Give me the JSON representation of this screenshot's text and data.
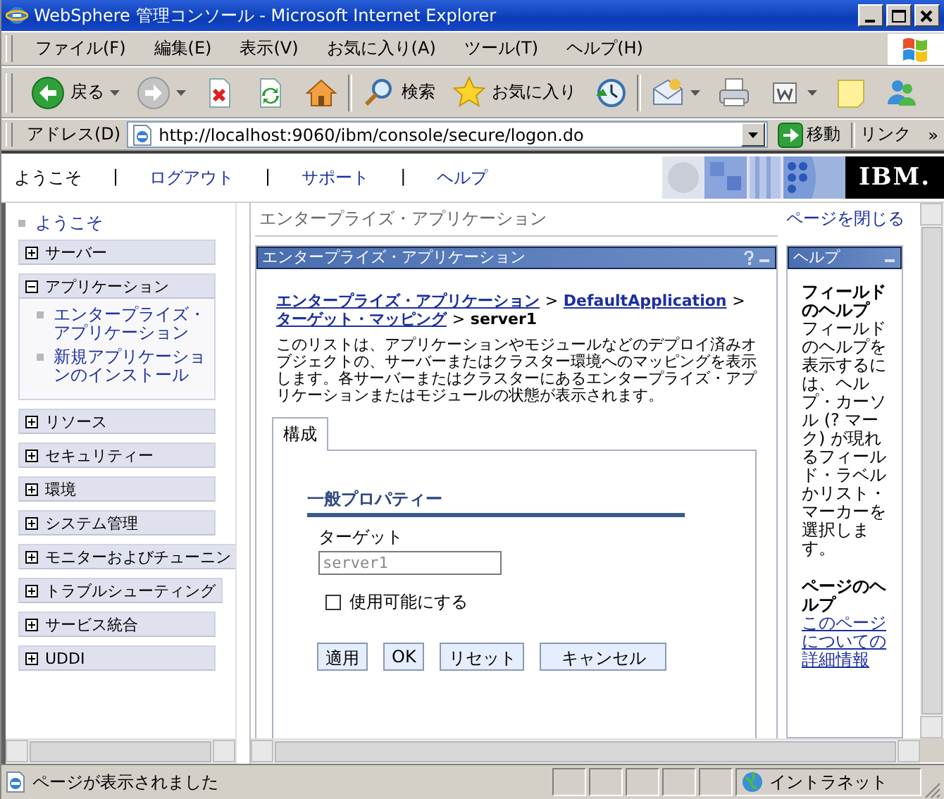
{
  "window": {
    "title": "WebSphere 管理コンソール - Microsoft Internet Explorer"
  },
  "menu": [
    "ファイル(F)",
    "編集(E)",
    "表示(V)",
    "お気に入り(A)",
    "ツール(T)",
    "ヘルプ(H)"
  ],
  "toolbar": [
    {
      "kind": "back",
      "label": "戻る",
      "menu": true
    },
    {
      "kind": "forward",
      "menu": true
    },
    {
      "kind": "stop",
      "menu": false
    },
    {
      "kind": "refresh",
      "menu": false
    },
    {
      "kind": "home",
      "menu": false
    },
    {
      "kind": "search",
      "label": "検索",
      "menu": false
    },
    {
      "kind": "favorites",
      "label": "お気に入り",
      "menu": false
    },
    {
      "kind": "history",
      "menu": false
    },
    {
      "kind": "mail",
      "menu": true
    },
    {
      "kind": "print",
      "menu": false
    },
    {
      "kind": "edit",
      "menu": true
    },
    {
      "kind": "note",
      "menu": false
    },
    {
      "kind": "people",
      "menu": false
    }
  ],
  "address": {
    "label": "アドレス(D)",
    "value": "http://localhost:9060/ibm/console/secure/logon.do",
    "go": "移動",
    "links": "リンク",
    "more": "»"
  },
  "banner": {
    "items": [
      {
        "kind": "text",
        "label": "ようこそ"
      },
      {
        "kind": "sep",
        "label": "|"
      },
      {
        "kind": "link",
        "label": "ログアウト"
      },
      {
        "kind": "sep",
        "label": "|"
      },
      {
        "kind": "link",
        "label": "サポート"
      },
      {
        "kind": "sep",
        "label": "|"
      },
      {
        "kind": "link",
        "label": "ヘルプ"
      }
    ],
    "logo": "IBM."
  },
  "nav": {
    "welcome": "ようこそ",
    "groups": [
      {
        "label": "サーバー",
        "expanded": false
      },
      {
        "label": "アプリケーション",
        "expanded": true,
        "children": [
          {
            "label": "エンタープライズ・アプリケーション"
          },
          {
            "label": "新規アプリケーションのインストール"
          }
        ]
      },
      {
        "label": "リソース",
        "expanded": false
      },
      {
        "label": "セキュリティー",
        "expanded": false
      },
      {
        "label": "環境",
        "expanded": false
      },
      {
        "label": "システム管理",
        "expanded": false
      },
      {
        "label": "モニターおよびチューニン",
        "expanded": false
      },
      {
        "label": "トラブルシューティング",
        "expanded": false
      },
      {
        "label": "サービス統合",
        "expanded": false
      },
      {
        "label": "UDDI",
        "expanded": false
      }
    ]
  },
  "content": {
    "page_title": "エンタープライズ・アプリケーション",
    "close_page": "ページを閉じる",
    "panel": {
      "title": "エンタープライズ・アプリケーション",
      "breadcrumb": [
        {
          "kind": "link",
          "label": "エンタープライズ・アプリケーション"
        },
        {
          "kind": "sep",
          "label": ">"
        },
        {
          "kind": "link",
          "label": "DefaultApplication"
        },
        {
          "kind": "sep",
          "label": ">"
        },
        {
          "kind": "link",
          "label": "ターゲット・マッピング"
        },
        {
          "kind": "sep",
          "label": ">"
        },
        {
          "kind": "current",
          "label": "server1"
        }
      ],
      "description": "このリストは、アプリケーションやモジュールなどのデプロイ済みオブジェクトの、サーバーまたはクラスター環境へのマッピングを表示します。各サーバーまたはクラスターにあるエンタープライズ・アプリケーションまたはモジュールの状態が表示されます。",
      "tabs": [
        {
          "label": "構成",
          "selected": true
        }
      ],
      "section": "一般プロパティー",
      "field": {
        "label": "ターゲット",
        "value": "server1",
        "disabled": true
      },
      "checkbox": {
        "label": "使用可能にする",
        "checked": false
      },
      "buttons": [
        "適用",
        "OK",
        "リセット",
        "キャンセル"
      ]
    }
  },
  "help": {
    "title": "ヘルプ",
    "field_help_title": "フィールドのヘルプ",
    "field_help": "フィールドのヘルプを表示するには、ヘルプ・カーソル (? マーク) が現れるフィールド・ラベルかリスト・マーカーを選択します。",
    "page_help_title": "ページのヘルプ",
    "page_help_link": "このページについての詳細情報"
  },
  "status_bar": {
    "text": "ページが表示されました",
    "zone": "イントラネット"
  }
}
